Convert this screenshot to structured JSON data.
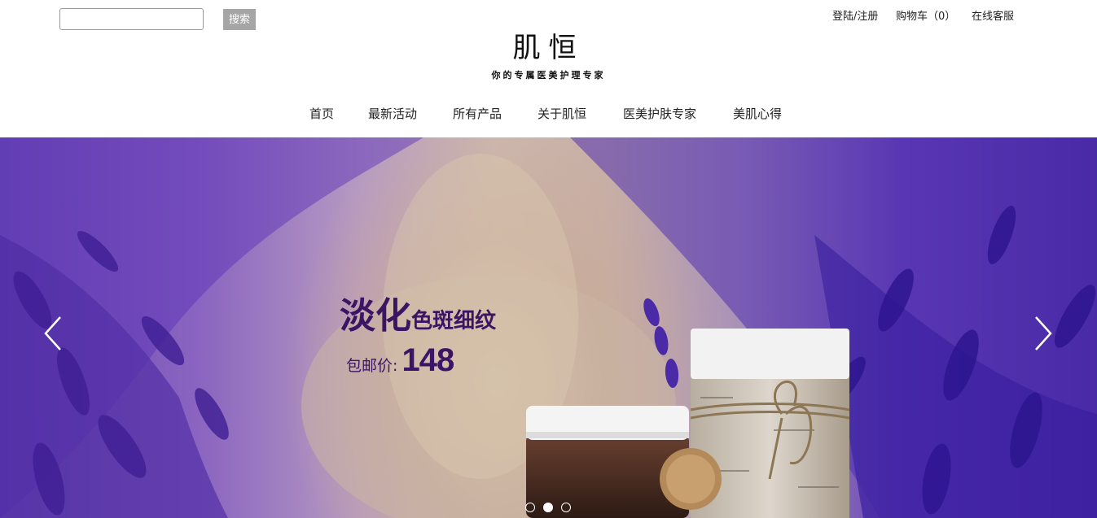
{
  "header": {
    "search": {
      "placeholder": "",
      "value": "",
      "button_label": "搜索"
    },
    "top_links": {
      "login": "登陆/注册",
      "cart": "购物车（0）",
      "service": "在线客服"
    },
    "logo": "肌恒",
    "tagline": "你的专属医美护理专家"
  },
  "nav": {
    "items": [
      {
        "label": "首页"
      },
      {
        "label": "最新活动"
      },
      {
        "label": "所有产品"
      },
      {
        "label": "关于肌恒"
      },
      {
        "label": "医美护肤专家"
      },
      {
        "label": "美肌心得"
      }
    ]
  },
  "banner": {
    "headline_big": "淡化",
    "headline_small": "色斑细纹",
    "price_label": "包邮价:",
    "price_value": "148",
    "slide_count": 3,
    "active_slide": 2,
    "colors": {
      "headline": "#3b1466",
      "lavender": "#6a3fc0"
    }
  },
  "icons": {
    "prev": "chevron-left-icon",
    "next": "chevron-right-icon"
  }
}
